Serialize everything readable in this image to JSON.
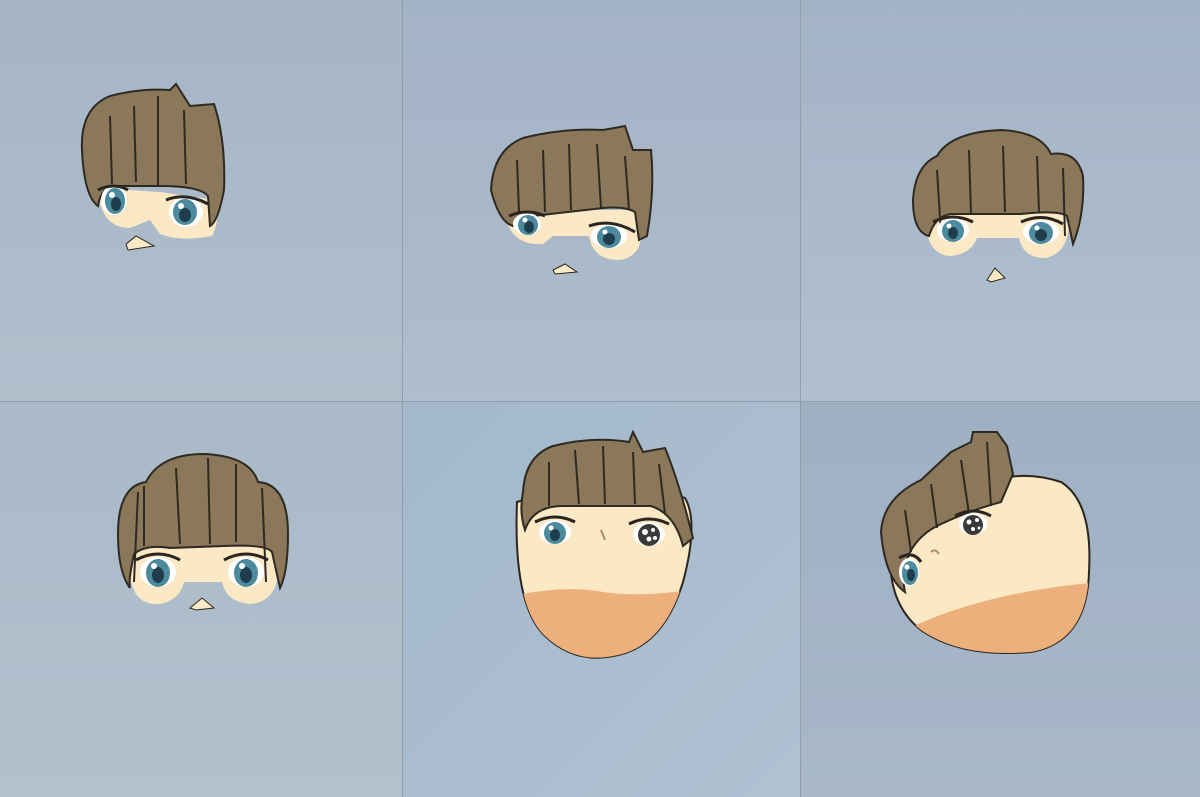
{
  "grid": {
    "rows": 2,
    "columns": 3,
    "panels": [
      {
        "id": 1,
        "subject": "chibi-head-hair-eyes-nose",
        "background": "#a9b8c8"
      },
      {
        "id": 2,
        "subject": "chibi-head-hair-eyes-nose",
        "background": "#a8b7c9"
      },
      {
        "id": 3,
        "subject": "chibi-head-hair-eyes-nose",
        "background": "#a8b8ca"
      },
      {
        "id": 4,
        "subject": "chibi-head-hair-eyes-nose",
        "background": "#adbcc8"
      },
      {
        "id": 5,
        "subject": "chibi-head-full-face",
        "background": "#a9bccf"
      },
      {
        "id": 6,
        "subject": "chibi-head-full-face-tilted",
        "background": "#a2b2c4"
      }
    ]
  },
  "colors": {
    "hair": "#8b7759",
    "hair_line": "#2e2a22",
    "skin": "#fbe8c4",
    "skin_shadow": "#edb07c",
    "iris": "#4c8a9d",
    "pupil": "#1f3d4c",
    "outline": "#2a2520"
  }
}
